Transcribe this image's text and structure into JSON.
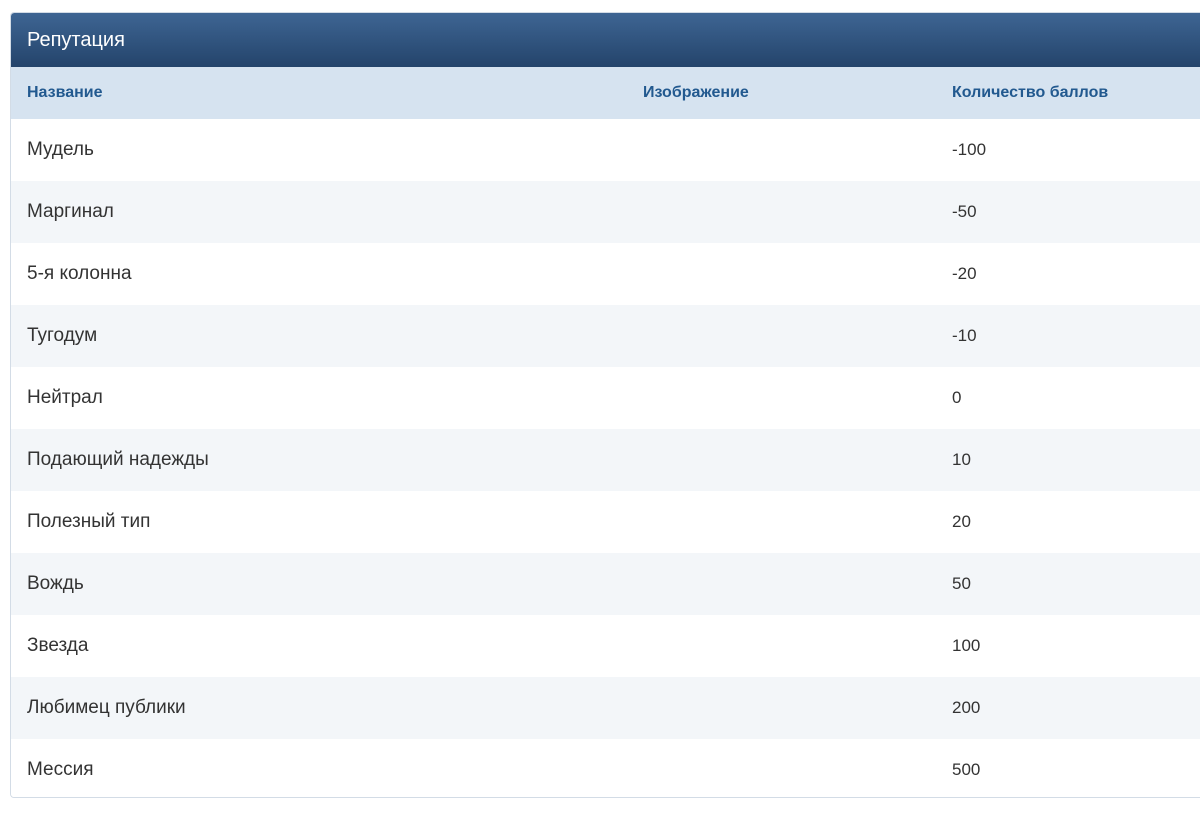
{
  "panel": {
    "title": "Репутация"
  },
  "columns": {
    "name": "Название",
    "image": "Изображение",
    "points": "Количество баллов"
  },
  "rows": [
    {
      "name": "Мудель",
      "points": "-100"
    },
    {
      "name": "Маргинал",
      "points": "-50"
    },
    {
      "name": "5-я колонна",
      "points": "-20"
    },
    {
      "name": "Тугодум",
      "points": "-10"
    },
    {
      "name": "Нейтрал",
      "points": "0"
    },
    {
      "name": "Подающий надежды",
      "points": "10"
    },
    {
      "name": "Полезный тип",
      "points": "20"
    },
    {
      "name": "Вождь",
      "points": "50"
    },
    {
      "name": "Звезда",
      "points": "100"
    },
    {
      "name": "Любимец публики",
      "points": "200"
    },
    {
      "name": "Мессия",
      "points": "500"
    }
  ],
  "colors": {
    "header_bg_top": "#3e6593",
    "header_bg_bottom": "#24446b",
    "column_header_bg": "#d6e3f0",
    "column_header_text": "#22598f",
    "row_alt_bg": "#f3f6f9"
  }
}
